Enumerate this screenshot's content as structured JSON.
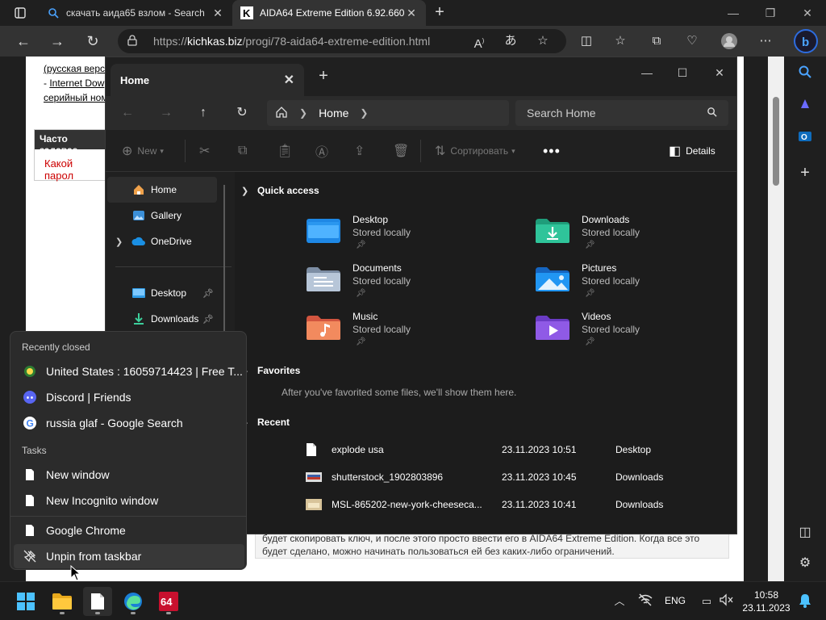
{
  "browser": {
    "tabs": [
      {
        "title": "скачать аида65 взлом - Search",
        "icon": "search-icon"
      },
      {
        "title": "AIDA64 Extreme Edition 6.92.660",
        "icon": "k-favicon-icon"
      }
    ],
    "url": {
      "prefix": "https://",
      "host": "kichkas.biz",
      "path": "/progi/78-aida64-extreme-edition.html"
    }
  },
  "webpage": {
    "line1": "(русская верс",
    "line2_prefix": "- ",
    "line2_link": "Internet Dow",
    "line3": "серийный ном",
    "faq_header": "Часто задавае",
    "faq_question": "Какой парол",
    "bottom_text_1": "будет скопировать ключ, и после этого просто ввести его в AIDA64 Extreme Edition. Когда все это",
    "bottom_text_2": "будет сделано, можно начинать пользоваться ей без каких-либо ограничений."
  },
  "explorer": {
    "tab_title": "Home",
    "address": {
      "location": "Home"
    },
    "search_placeholder": "Search Home",
    "commands": {
      "new": "New",
      "sort": "Сортировать",
      "more": "•••",
      "details": "Details"
    },
    "nav": [
      {
        "label": "Home",
        "icon": "home-icon",
        "selected": true
      },
      {
        "label": "Gallery",
        "icon": "gallery-icon"
      },
      {
        "label": "OneDrive",
        "icon": "onedrive-icon",
        "expandable": true
      },
      {
        "label": "Desktop",
        "icon": "desktop-folder-icon",
        "pinned": true
      },
      {
        "label": "Downloads",
        "icon": "downloads-folder-icon",
        "pinned": true
      }
    ],
    "quick_access_title": "Quick access",
    "quick_access": [
      {
        "name": "Desktop",
        "status": "Stored locally",
        "icon": "desktop-folder-icon"
      },
      {
        "name": "Downloads",
        "status": "Stored locally",
        "icon": "downloads-folder-icon"
      },
      {
        "name": "Documents",
        "status": "Stored locally",
        "icon": "documents-folder-icon"
      },
      {
        "name": "Pictures",
        "status": "Stored locally",
        "icon": "pictures-folder-icon"
      },
      {
        "name": "Music",
        "status": "Stored locally",
        "icon": "music-folder-icon"
      },
      {
        "name": "Videos",
        "status": "Stored locally",
        "icon": "videos-folder-icon"
      }
    ],
    "favorites_title": "Favorites",
    "favorites_empty": "After you've favorited some files, we'll show them here.",
    "recent_title": "Recent",
    "recent": [
      {
        "name": "explode usa",
        "date": "23.11.2023 10:51",
        "location": "Desktop",
        "icon": "file-icon"
      },
      {
        "name": "shutterstock_1902803896",
        "date": "23.11.2023 10:45",
        "location": "Downloads",
        "icon": "image-thumb-icon"
      },
      {
        "name": "MSL-865202-new-york-cheeseca...",
        "date": "23.11.2023 10:41",
        "location": "Downloads",
        "icon": "image-thumb-icon"
      }
    ]
  },
  "jumplist": {
    "recently_closed_title": "Recently closed",
    "recently_closed": [
      {
        "label": "United States : 16059714423 | Free T...",
        "icon": "globe-favicon-icon"
      },
      {
        "label": "Discord | Friends",
        "icon": "discord-icon"
      },
      {
        "label": "russia glaf - Google Search",
        "icon": "google-icon"
      }
    ],
    "tasks_title": "Tasks",
    "tasks": [
      {
        "label": "New window",
        "icon": "document-icon"
      },
      {
        "label": "New Incognito window",
        "icon": "document-icon"
      }
    ],
    "app": {
      "label": "Google Chrome",
      "icon": "document-icon"
    },
    "unpin": {
      "label": "Unpin from taskbar",
      "icon": "unpin-icon"
    }
  },
  "taskbar": {
    "apps": [
      "start-icon",
      "file-explorer-icon",
      "document-app-icon",
      "edge-icon",
      "aida64-icon"
    ],
    "language": "ENG",
    "time": "10:58",
    "date": "23.11.2023"
  },
  "colors": {
    "accent": "#4cc2ff",
    "browser_bg": "#1f1f1f",
    "explorer_bg": "#202020"
  }
}
